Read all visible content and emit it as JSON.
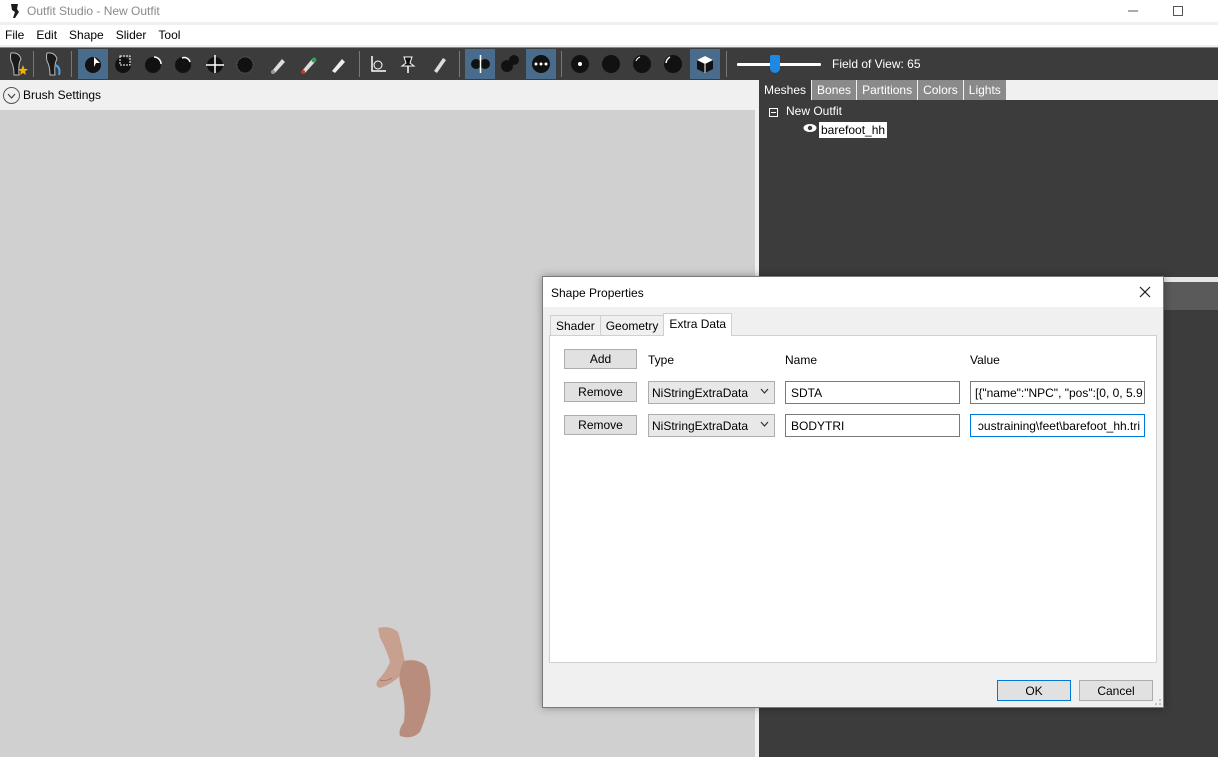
{
  "window": {
    "title": "Outfit Studio - New Outfit"
  },
  "menu": [
    "File",
    "Edit",
    "Shape",
    "Slider",
    "Tool"
  ],
  "toolbar": {
    "fov_label": "Field of View: 65",
    "fov_value": 65
  },
  "left_panel": {
    "brush_settings_label": "Brush Settings"
  },
  "right_panel": {
    "tabs": [
      "Meshes",
      "Bones",
      "Partitions",
      "Colors",
      "Lights"
    ],
    "active_tab": "Meshes",
    "tree_root": "New Outfit",
    "tree_child": "barefoot_hh"
  },
  "dialog": {
    "title": "Shape Properties",
    "tabs": [
      "Shader",
      "Geometry",
      "Extra Data"
    ],
    "active_tab": "Extra Data",
    "add_label": "Add",
    "headers": {
      "type": "Type",
      "name": "Name",
      "value": "Value"
    },
    "rows": [
      {
        "remove_label": "Remove",
        "type": "NiStringExtraData",
        "name": "SDTA",
        "value": "[{\"name\":\"NPC\", \"pos\":[0, 0, 5.9"
      },
      {
        "remove_label": "Remove",
        "type": "NiStringExtraData",
        "name": "BODYTRI",
        "value": "ɔustraining\\feet\\barefoot_hh.tri"
      }
    ],
    "ok_label": "OK",
    "cancel_label": "Cancel"
  },
  "colors": {
    "toolbar_bg": "#3c3c3c",
    "viewport_bg": "#d0d0d0",
    "active_tool": "#4a6c8c",
    "accent": "#0078d7",
    "slider_thumb": "#1e88e5"
  }
}
